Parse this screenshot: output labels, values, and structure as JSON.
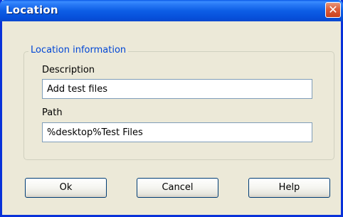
{
  "window": {
    "title": "Location",
    "close_glyph": "✕"
  },
  "group": {
    "legend": "Location information"
  },
  "fields": {
    "description": {
      "label": "Description",
      "value": "Add test files"
    },
    "path": {
      "label": "Path",
      "value": "%desktop%Test Files"
    }
  },
  "buttons": {
    "ok": "Ok",
    "cancel": "Cancel",
    "help": "Help"
  },
  "colors": {
    "titlebar": "#0a58e6",
    "legend_text": "#0046d5",
    "window_bg": "#ece9d8",
    "close_button": "#dd5d3a"
  }
}
